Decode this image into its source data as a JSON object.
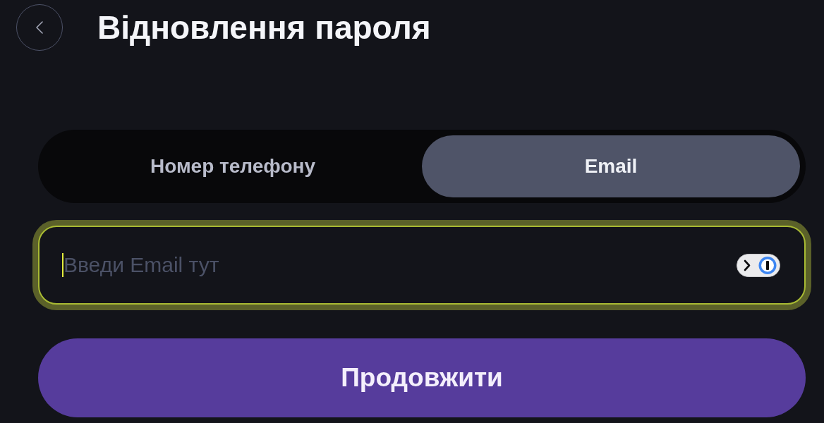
{
  "header": {
    "title": "Відновлення пароля"
  },
  "tabs": [
    {
      "label": "Номер телефону",
      "selected": false
    },
    {
      "label": "Email",
      "selected": true
    }
  ],
  "email_field": {
    "placeholder": "Введи Email тут",
    "focused": true
  },
  "continue_button": {
    "label": "Продовжити"
  }
}
